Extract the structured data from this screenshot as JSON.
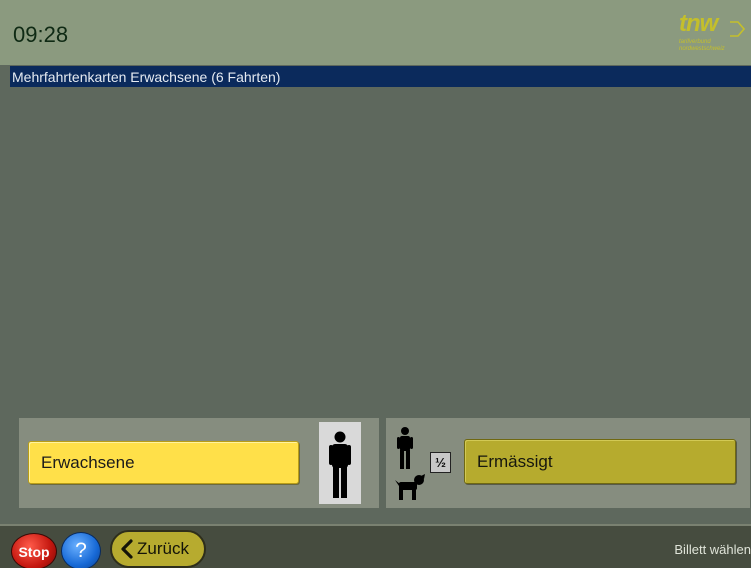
{
  "header": {
    "time": "09:28",
    "logo_text": "tnw",
    "logo_subtext": "tarifverbund nordwestschweiz"
  },
  "titlebar": {
    "title": "Mehrfahrtenkarten Erwachsene (6 Fahrten)"
  },
  "options": {
    "adult": {
      "label": "Erwachsene",
      "icon": "adult-person-icon"
    },
    "reduced": {
      "label": "Ermässigt",
      "half_label": "½",
      "icons": [
        "child-person-icon",
        "half-fare-icon",
        "dog-icon"
      ]
    }
  },
  "footer": {
    "stop_label": "Stop",
    "help_label": "?",
    "back_label": "Zurück",
    "status": "Billett wählen"
  },
  "colors": {
    "header_bg": "#8b9a7f",
    "titlebar_bg": "#0b2a5c",
    "content_bg": "#5e685d",
    "adult_button": "#ffe049",
    "reduced_button": "#b6ab2e",
    "logo": "#c4bf2b"
  }
}
